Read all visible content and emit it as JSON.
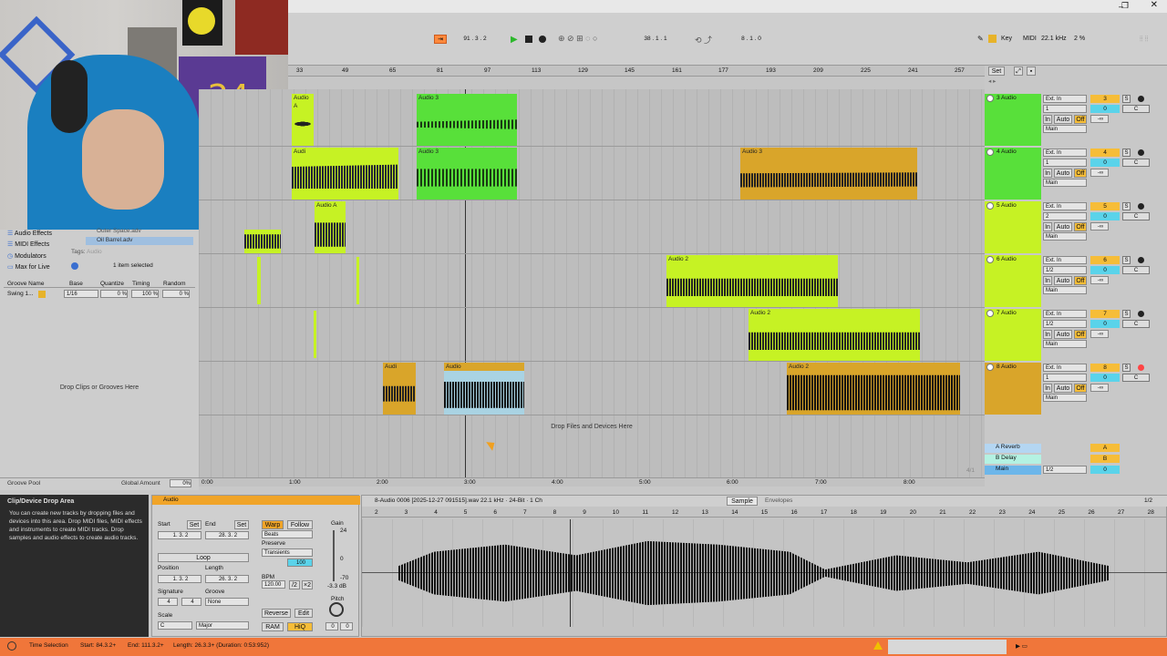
{
  "colors": {
    "green": "#58e03a",
    "lime": "#c6f224",
    "orange": "#d9a52a",
    "sky": "#a9d3e3",
    "selection": "#ff7f35",
    "status": "#f0763a"
  },
  "transport": {
    "tempo_pos": "91 . 3 . 2",
    "loop_start": "38 . 1 . 1",
    "loop_end": "8 . 1 . 0",
    "key_label": "Key",
    "midi_label": "MIDI",
    "sample_rate": "22.1 kHz",
    "cpu": "2 %"
  },
  "ruler": {
    "bars": [
      "33",
      "49",
      "65",
      "81",
      "97",
      "113",
      "129",
      "145",
      "161",
      "177",
      "193",
      "209",
      "225",
      "241",
      "257"
    ],
    "set_label": "Set",
    "times": [
      "0:00",
      "1:00",
      "2:00",
      "3:00",
      "4:00",
      "5:00",
      "6:00",
      "7:00",
      "8:00"
    ],
    "zoom": "4/1"
  },
  "browser": {
    "items": [
      "Audio Effects",
      "MIDI Effects",
      "Modulators",
      "Max for Live"
    ],
    "presets": [
      "Outer Space.adv",
      "Oil Barrel.adv"
    ],
    "tags_label": "Tags:",
    "tags_value": "Audio",
    "selected": "1 item selected",
    "drop_grooves": "Drop Clips or Grooves Here",
    "groove_pool": "Groove Pool",
    "global_amount_label": "Global Amount",
    "global_amount": "0%"
  },
  "groove": {
    "headers": [
      "Groove Name",
      "Base",
      "Quantize",
      "Timing",
      "Random"
    ],
    "row": {
      "name": "Swing 1...",
      "base": "1/16",
      "quantize": "0 %",
      "timing": "100 %",
      "random": "0 %"
    }
  },
  "tracks": [
    {
      "name": "3 Audio",
      "input": "Ext. In",
      "ch": "1",
      "num": "3",
      "vol": "0",
      "pan": "C",
      "color": "#58e03a"
    },
    {
      "name": "4 Audio",
      "input": "Ext. In",
      "ch": "1",
      "num": "4",
      "vol": "0",
      "pan": "C",
      "color": "#58e03a"
    },
    {
      "name": "5 Audio",
      "input": "Ext. In",
      "ch": "2",
      "num": "5",
      "vol": "0",
      "pan": "C",
      "color": "#c6f224"
    },
    {
      "name": "6 Audio",
      "input": "Ext. In",
      "ch": "1/2",
      "num": "6",
      "vol": "0",
      "pan": "C",
      "color": "#c6f224"
    },
    {
      "name": "7 Audio",
      "input": "Ext. In",
      "ch": "1/2",
      "num": "7",
      "vol": "0",
      "pan": "C",
      "color": "#c6f224"
    },
    {
      "name": "8 Audio",
      "input": "Ext. In",
      "ch": "1",
      "num": "8",
      "vol": "0",
      "pan": "C",
      "color": "#d9a52a"
    }
  ],
  "io_labels": {
    "in": "In",
    "auto": "Auto",
    "off": "Off",
    "main": "Main",
    "s": "S",
    "inf": "-∞"
  },
  "returns": [
    {
      "name": "A Reverb",
      "letter": "A"
    },
    {
      "name": "B Delay",
      "letter": "B"
    },
    {
      "name": "Main",
      "letter": "0",
      "out": "1/2"
    }
  ],
  "drop_files": "Drop Files and Devices Here",
  "clips": {
    "audio3": "Audio 3",
    "audio2": "Audio 2",
    "audio": "Audio",
    "audio_a": "Audio A",
    "audio_short": "Audi"
  },
  "info": {
    "title": "Clip/Device Drop Area",
    "body": "You can create new tracks by dropping files and devices into this area. Drop MIDI files, MIDI effects and instruments to create MIDI tracks. Drop samples and audio effects to create audio tracks."
  },
  "clip_view": {
    "name": "Audio",
    "start_label": "Start",
    "end_label": "End",
    "set": "Set",
    "start": [
      "1",
      "3",
      "2"
    ],
    "end": [
      "28",
      "3",
      "2"
    ],
    "loop": "Loop",
    "position_label": "Position",
    "length_label": "Length",
    "position": [
      "1",
      "3",
      "2"
    ],
    "length": [
      "26",
      "3",
      "2"
    ],
    "signature_label": "Signature",
    "groove_label": "Groove",
    "sig": [
      "4",
      "4"
    ],
    "groove_val": "None",
    "scale_label": "Scale",
    "scale_root": "C",
    "scale_mode": "Major",
    "warp": "Warp",
    "follow": "Follow",
    "mode": "Beats",
    "preserve_label": "Preserve",
    "preserve": "Transients",
    "amount": "100",
    "bpm_label": "BPM",
    "bpm": "120.00",
    "half": "/2",
    "double": "×2",
    "reverse": "Reverse",
    "edit": "Edit",
    "ram": "RAM",
    "hiq": "HiQ",
    "gain_label": "Gain",
    "gain_db": "-3.3 dB",
    "pitch_label": "Pitch",
    "pitch": [
      "0",
      "0"
    ],
    "scale_nums": [
      "24",
      "0",
      "-70"
    ]
  },
  "sample": {
    "file": "8-Audio 0006 [2025-12-27 091515].wav  22.1 kHz · 24-Bit · 1 Ch",
    "tab_sample": "Sample",
    "tab_env": "Envelopes",
    "page": "1/2",
    "ruler": [
      "2",
      "3",
      "4",
      "5",
      "6",
      "7",
      "8",
      "9",
      "10",
      "11",
      "12",
      "13",
      "14",
      "15",
      "16",
      "17",
      "18",
      "19",
      "20",
      "21",
      "22",
      "23",
      "24",
      "25",
      "26",
      "27",
      "28"
    ]
  },
  "status": {
    "label": "Time Selection",
    "start": "Start: 84.3.2+",
    "end": "End: 111.3.2+",
    "length": "Length: 26.3.3+ (Duration: 0:53:952)"
  }
}
